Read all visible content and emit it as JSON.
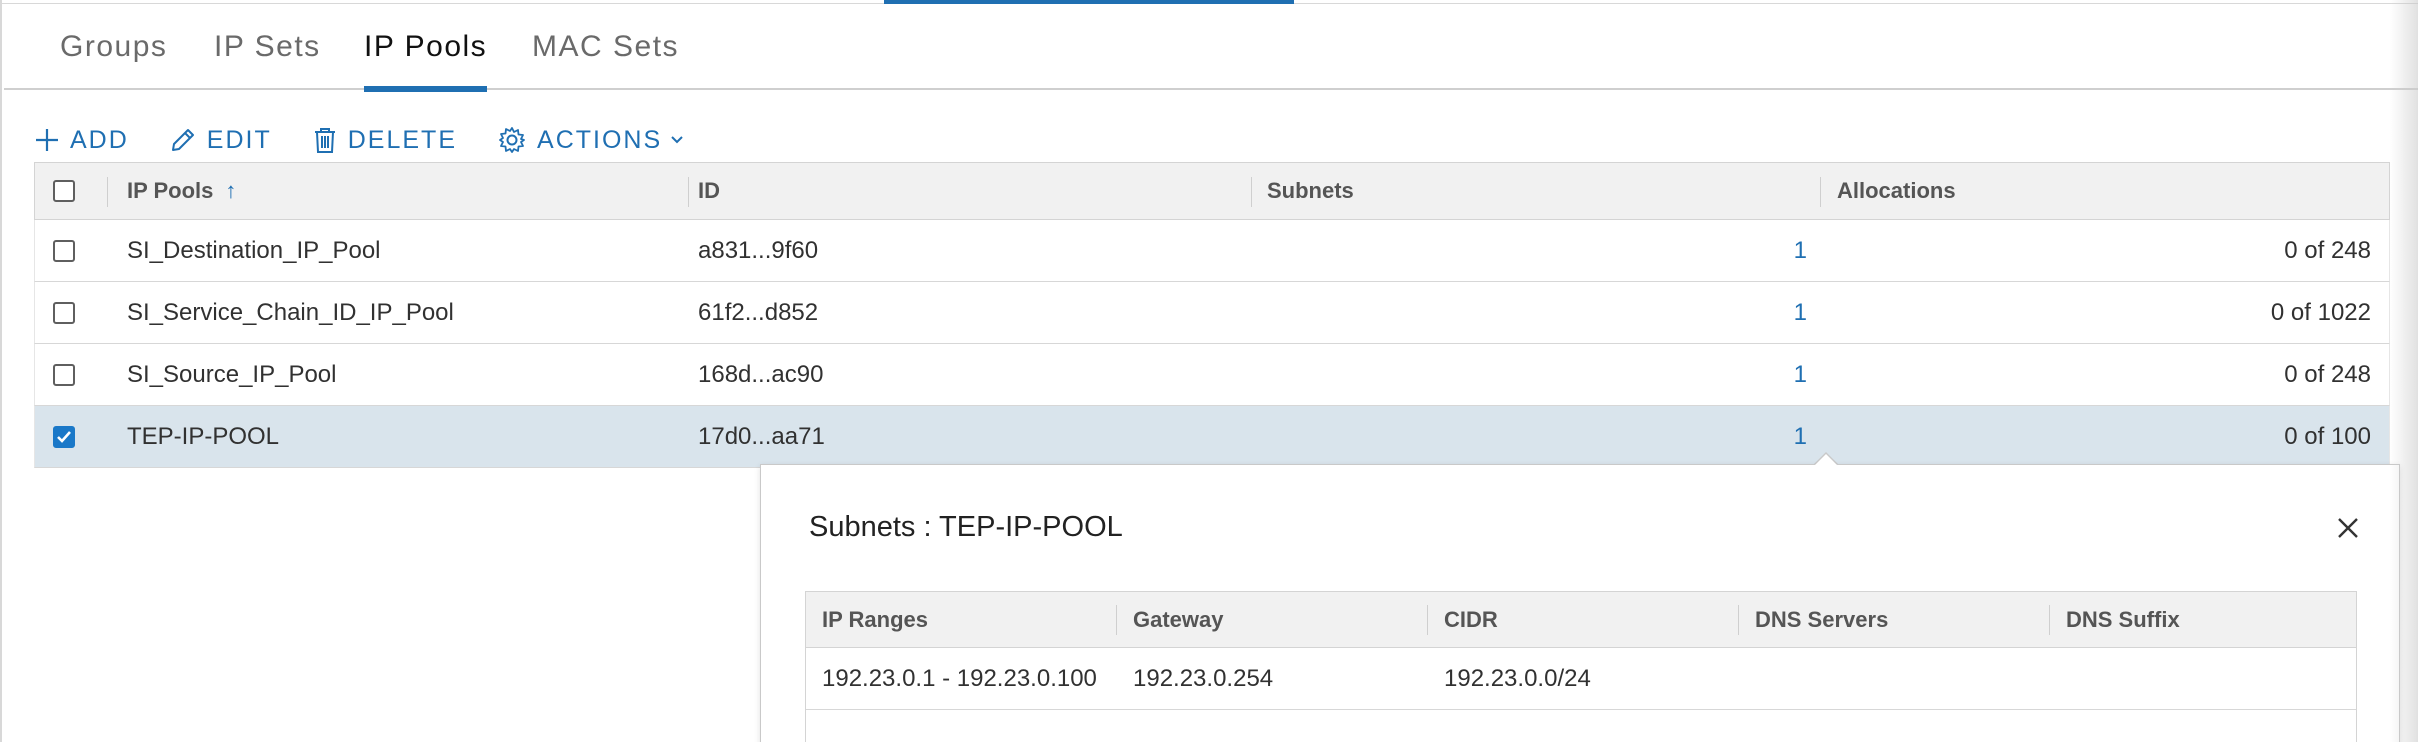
{
  "tabs": [
    {
      "label": "Groups",
      "active": false
    },
    {
      "label": "IP Sets",
      "active": false
    },
    {
      "label": "IP Pools",
      "active": true
    },
    {
      "label": "MAC Sets",
      "active": false
    }
  ],
  "toolbar": {
    "add": "ADD",
    "edit": "EDIT",
    "delete": "DELETE",
    "actions": "ACTIONS"
  },
  "table": {
    "columns": {
      "name": "IP Pools",
      "name_sort": "↑",
      "id": "ID",
      "subnets": "Subnets",
      "allocations": "Allocations"
    },
    "rows": [
      {
        "name": "SI_Destination_IP_Pool",
        "id": "a831...9f60",
        "subnets": "1",
        "allocations": "0 of 248",
        "selected": false
      },
      {
        "name": "SI_Service_Chain_ID_IP_Pool",
        "id": "61f2...d852",
        "subnets": "1",
        "allocations": "0 of 1022",
        "selected": false
      },
      {
        "name": "SI_Source_IP_Pool",
        "id": "168d...ac90",
        "subnets": "1",
        "allocations": "0 of 248",
        "selected": false
      },
      {
        "name": "TEP-IP-POOL",
        "id": "17d0...aa71",
        "subnets": "1",
        "allocations": "0 of 100",
        "selected": true
      }
    ]
  },
  "popover": {
    "title": "Subnets : TEP-IP-POOL",
    "columns": {
      "ip_ranges": "IP Ranges",
      "gateway": "Gateway",
      "cidr": "CIDR",
      "dns_servers": "DNS Servers",
      "dns_suffix": "DNS Suffix"
    },
    "rows": [
      {
        "ip_ranges": "192.23.0.1 - 192.23.0.100",
        "gateway": "192.23.0.254",
        "cidr": "192.23.0.0/24",
        "dns_servers": "",
        "dns_suffix": ""
      }
    ]
  },
  "colors": {
    "accent": "#1f6fb2",
    "selected_row": "#d9e4ec",
    "header_bg": "#f1f1f1"
  }
}
